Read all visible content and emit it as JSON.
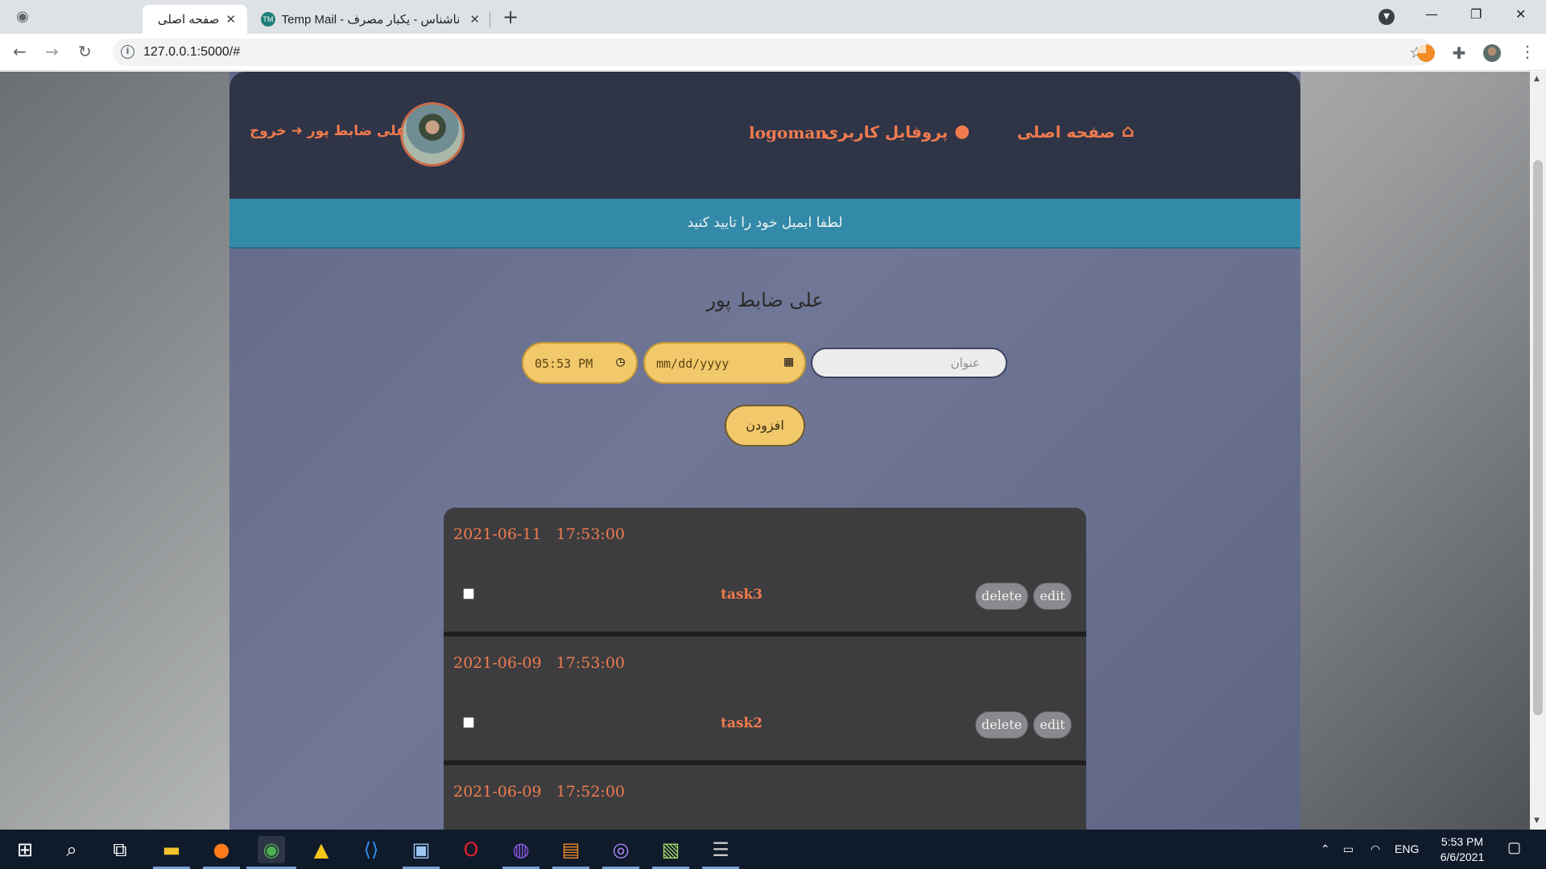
{
  "browser": {
    "tabs": [
      {
        "title": "صفحه اصلی",
        "active": true
      },
      {
        "title": "Temp Mail - ایمیل ناشناس - یکبار مصرف",
        "active": false
      }
    ],
    "url": "127.0.0.1:5000/#"
  },
  "header": {
    "home_label": "صفحه اصلی",
    "profile_label": "پروفایل کاربری",
    "brand": "logoman",
    "username": "علی ضابط پور",
    "logout_label": "خروج"
  },
  "alert": {
    "message": "لطفا ایمیل خود را تایید کنید"
  },
  "main": {
    "user_title": "علی ضابط پور",
    "form": {
      "time_value": "05:53 PM",
      "date_placeholder": "mm/dd/yyyy",
      "title_placeholder": "عنوان",
      "add_button": "افزودن"
    },
    "tasks": [
      {
        "date": "2021-06-11",
        "time": "17:53:00",
        "name": "task3",
        "checked": false
      },
      {
        "date": "2021-06-09",
        "time": "17:53:00",
        "name": "task2",
        "checked": false
      },
      {
        "date": "2021-06-09",
        "time": "17:52:00",
        "name": "",
        "checked": false
      }
    ],
    "task_buttons": {
      "edit": "edit",
      "delete": "delete"
    }
  },
  "taskbar": {
    "language": "ENG",
    "time": "5:53 PM",
    "date": "6/6/2021"
  },
  "colors": {
    "accent": "#f07b4f",
    "header_bg": "#2f3447",
    "alert_bg": "#3289a8",
    "field_bg": "#f1c86a",
    "task_bg": "#3d3d3f"
  }
}
